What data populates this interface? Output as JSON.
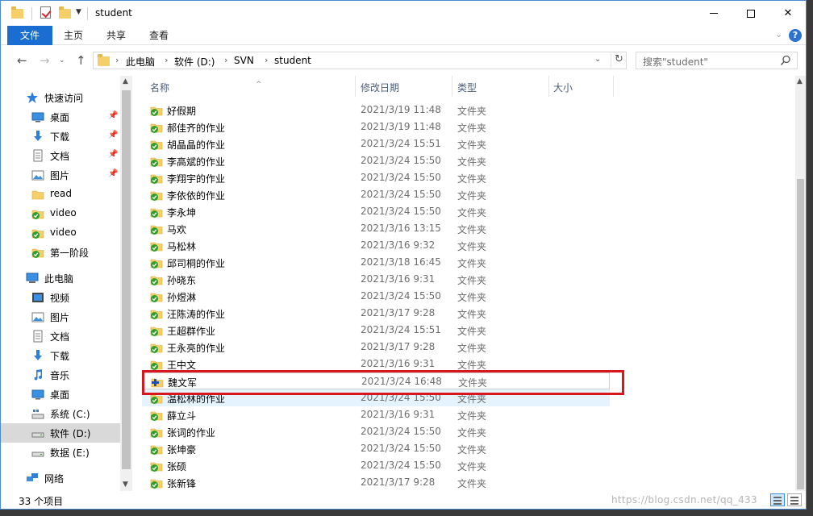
{
  "window": {
    "title": "student"
  },
  "ribbon": {
    "tabs": [
      "文件",
      "主页",
      "共享",
      "查看"
    ]
  },
  "address": {
    "crumbs": [
      "此电脑",
      "软件 (D:)",
      "SVN",
      "student"
    ]
  },
  "search": {
    "placeholder": "搜索\"student\""
  },
  "nav": {
    "quick_access": "快速访问",
    "quick_items": [
      {
        "label": "桌面",
        "icon": "desktop-icon",
        "pinned": true
      },
      {
        "label": "下载",
        "icon": "download-icon",
        "pinned": true
      },
      {
        "label": "文档",
        "icon": "document-icon",
        "pinned": true
      },
      {
        "label": "图片",
        "icon": "pictures-icon",
        "pinned": true
      },
      {
        "label": "read",
        "icon": "folder-icon",
        "pinned": false
      },
      {
        "label": "video",
        "icon": "svn-folder-icon",
        "pinned": false
      },
      {
        "label": "video",
        "icon": "svn-folder-icon",
        "pinned": false
      },
      {
        "label": "第一阶段",
        "icon": "svn-folder-icon",
        "pinned": false
      }
    ],
    "this_pc": "此电脑",
    "pc_items": [
      {
        "label": "视频",
        "icon": "video-icon"
      },
      {
        "label": "图片",
        "icon": "pictures-icon"
      },
      {
        "label": "文档",
        "icon": "document-icon"
      },
      {
        "label": "下载",
        "icon": "download-icon"
      },
      {
        "label": "音乐",
        "icon": "music-icon"
      },
      {
        "label": "桌面",
        "icon": "desktop-icon"
      },
      {
        "label": "系统 (C:)",
        "icon": "drive-c-icon"
      },
      {
        "label": "软件 (D:)",
        "icon": "drive-icon",
        "selected": true
      },
      {
        "label": "数据 (E:)",
        "icon": "drive-icon"
      }
    ],
    "network": "网络"
  },
  "columns": {
    "name": "名称",
    "date": "修改日期",
    "type": "类型",
    "size": "大小"
  },
  "files": [
    {
      "name": "好假期",
      "date": "2021/3/19 11:48",
      "type": "文件夹",
      "status": "ok"
    },
    {
      "name": "郝佳齐的作业",
      "date": "2021/3/19 11:48",
      "type": "文件夹",
      "status": "ok"
    },
    {
      "name": "胡晶晶的作业",
      "date": "2021/3/24 15:51",
      "type": "文件夹",
      "status": "ok"
    },
    {
      "name": "李高斌的作业",
      "date": "2021/3/24 15:50",
      "type": "文件夹",
      "status": "ok"
    },
    {
      "name": "李翔宇的作业",
      "date": "2021/3/24 15:50",
      "type": "文件夹",
      "status": "ok"
    },
    {
      "name": "李依依的作业",
      "date": "2021/3/24 15:50",
      "type": "文件夹",
      "status": "ok"
    },
    {
      "name": "李永坤",
      "date": "2021/3/24 15:50",
      "type": "文件夹",
      "status": "ok"
    },
    {
      "name": "马欢",
      "date": "2021/3/16 13:15",
      "type": "文件夹",
      "status": "ok"
    },
    {
      "name": "马松林",
      "date": "2021/3/16 9:32",
      "type": "文件夹",
      "status": "ok"
    },
    {
      "name": "邱司桐的作业",
      "date": "2021/3/18 16:45",
      "type": "文件夹",
      "status": "ok"
    },
    {
      "name": "孙晓东",
      "date": "2021/3/16 9:31",
      "type": "文件夹",
      "status": "ok"
    },
    {
      "name": "孙煜淋",
      "date": "2021/3/24 15:50",
      "type": "文件夹",
      "status": "ok"
    },
    {
      "name": "汪陈涛的作业",
      "date": "2021/3/17 9:28",
      "type": "文件夹",
      "status": "ok"
    },
    {
      "name": "王超群作业",
      "date": "2021/3/24 15:51",
      "type": "文件夹",
      "status": "ok"
    },
    {
      "name": "王永亮的作业",
      "date": "2021/3/17 9:28",
      "type": "文件夹",
      "status": "ok"
    },
    {
      "name": "王中文",
      "date": "2021/3/16 9:31",
      "type": "文件夹",
      "status": "ok"
    },
    {
      "name": "魏文军",
      "date": "2021/3/24 16:48",
      "type": "文件夹",
      "status": "added",
      "selected": true
    },
    {
      "name": "温松林的作业",
      "date": "2021/3/24 15:50",
      "type": "文件夹",
      "status": "ok"
    },
    {
      "name": "薛立斗",
      "date": "2021/3/16 9:31",
      "type": "文件夹",
      "status": "ok"
    },
    {
      "name": "张词的作业",
      "date": "2021/3/24 15:50",
      "type": "文件夹",
      "status": "ok"
    },
    {
      "name": "张坤豪",
      "date": "2021/3/24 15:50",
      "type": "文件夹",
      "status": "ok"
    },
    {
      "name": "张硕",
      "date": "2021/3/24 15:50",
      "type": "文件夹",
      "status": "ok"
    },
    {
      "name": "张新锋",
      "date": "2021/3/17 9:28",
      "type": "文件夹",
      "status": "ok"
    }
  ],
  "status": {
    "count": "33 个项目",
    "watermark": "https://blog.csdn.net/qq_433"
  },
  "colors": {
    "accent": "#1a6ed1",
    "highlight": "#d8161d",
    "svn_ok": "#2e9e2e",
    "folder": "#f4cf6a"
  }
}
